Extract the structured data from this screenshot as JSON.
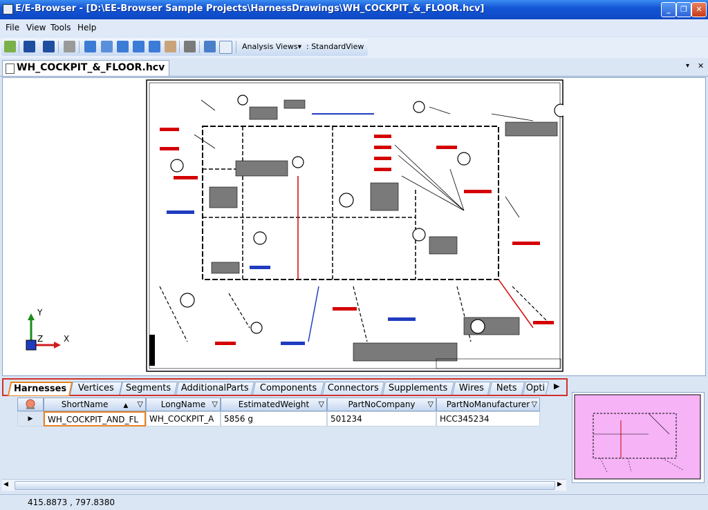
{
  "window": {
    "title": "E/E-Browser - [D:\\EE-Browser Sample Projects\\HarnessDrawings\\WH_COCKPIT_&_FLOOR.hcv]",
    "minimize": "_",
    "restore": "❐",
    "close": "✕"
  },
  "menu": [
    "File",
    "View",
    "Tools",
    "Help"
  ],
  "toolbar": {
    "analysis_views": "Analysis Views▾",
    "standard_view": ": StandardView"
  },
  "document_tab": {
    "label": "WH_COCKPIT_&_FLOOR.hcv",
    "dropdown": "▾",
    "close": "✕"
  },
  "axes": {
    "y": "Y",
    "x": "X",
    "z": "Z"
  },
  "bottom_tabs": [
    "Harnesses",
    "Vertices",
    "Segments",
    "AdditionalParts",
    "Components",
    "Connectors",
    "Supplements",
    "Wires",
    "Nets",
    "Opti"
  ],
  "active_tab": "Harnesses",
  "grid": {
    "columns": [
      "ShortName",
      "LongName",
      "EstimatedWeight",
      "PartNoCompany",
      "PartNoManufacturer"
    ],
    "rows": [
      {
        "ShortName": "WH_COCKPIT_AND_FL",
        "LongName": "WH_COCKPIT_A",
        "EstimatedWeight": "5856 g",
        "PartNoCompany": "501234",
        "PartNoManufacturer": "HCC345234"
      }
    ]
  },
  "status": {
    "coordinates": "415.8873 , 797.8380"
  },
  "colors": {
    "highlight": "#e8821e",
    "tab_border": "#d0302a",
    "overview_bg": "#f6b3f6"
  }
}
